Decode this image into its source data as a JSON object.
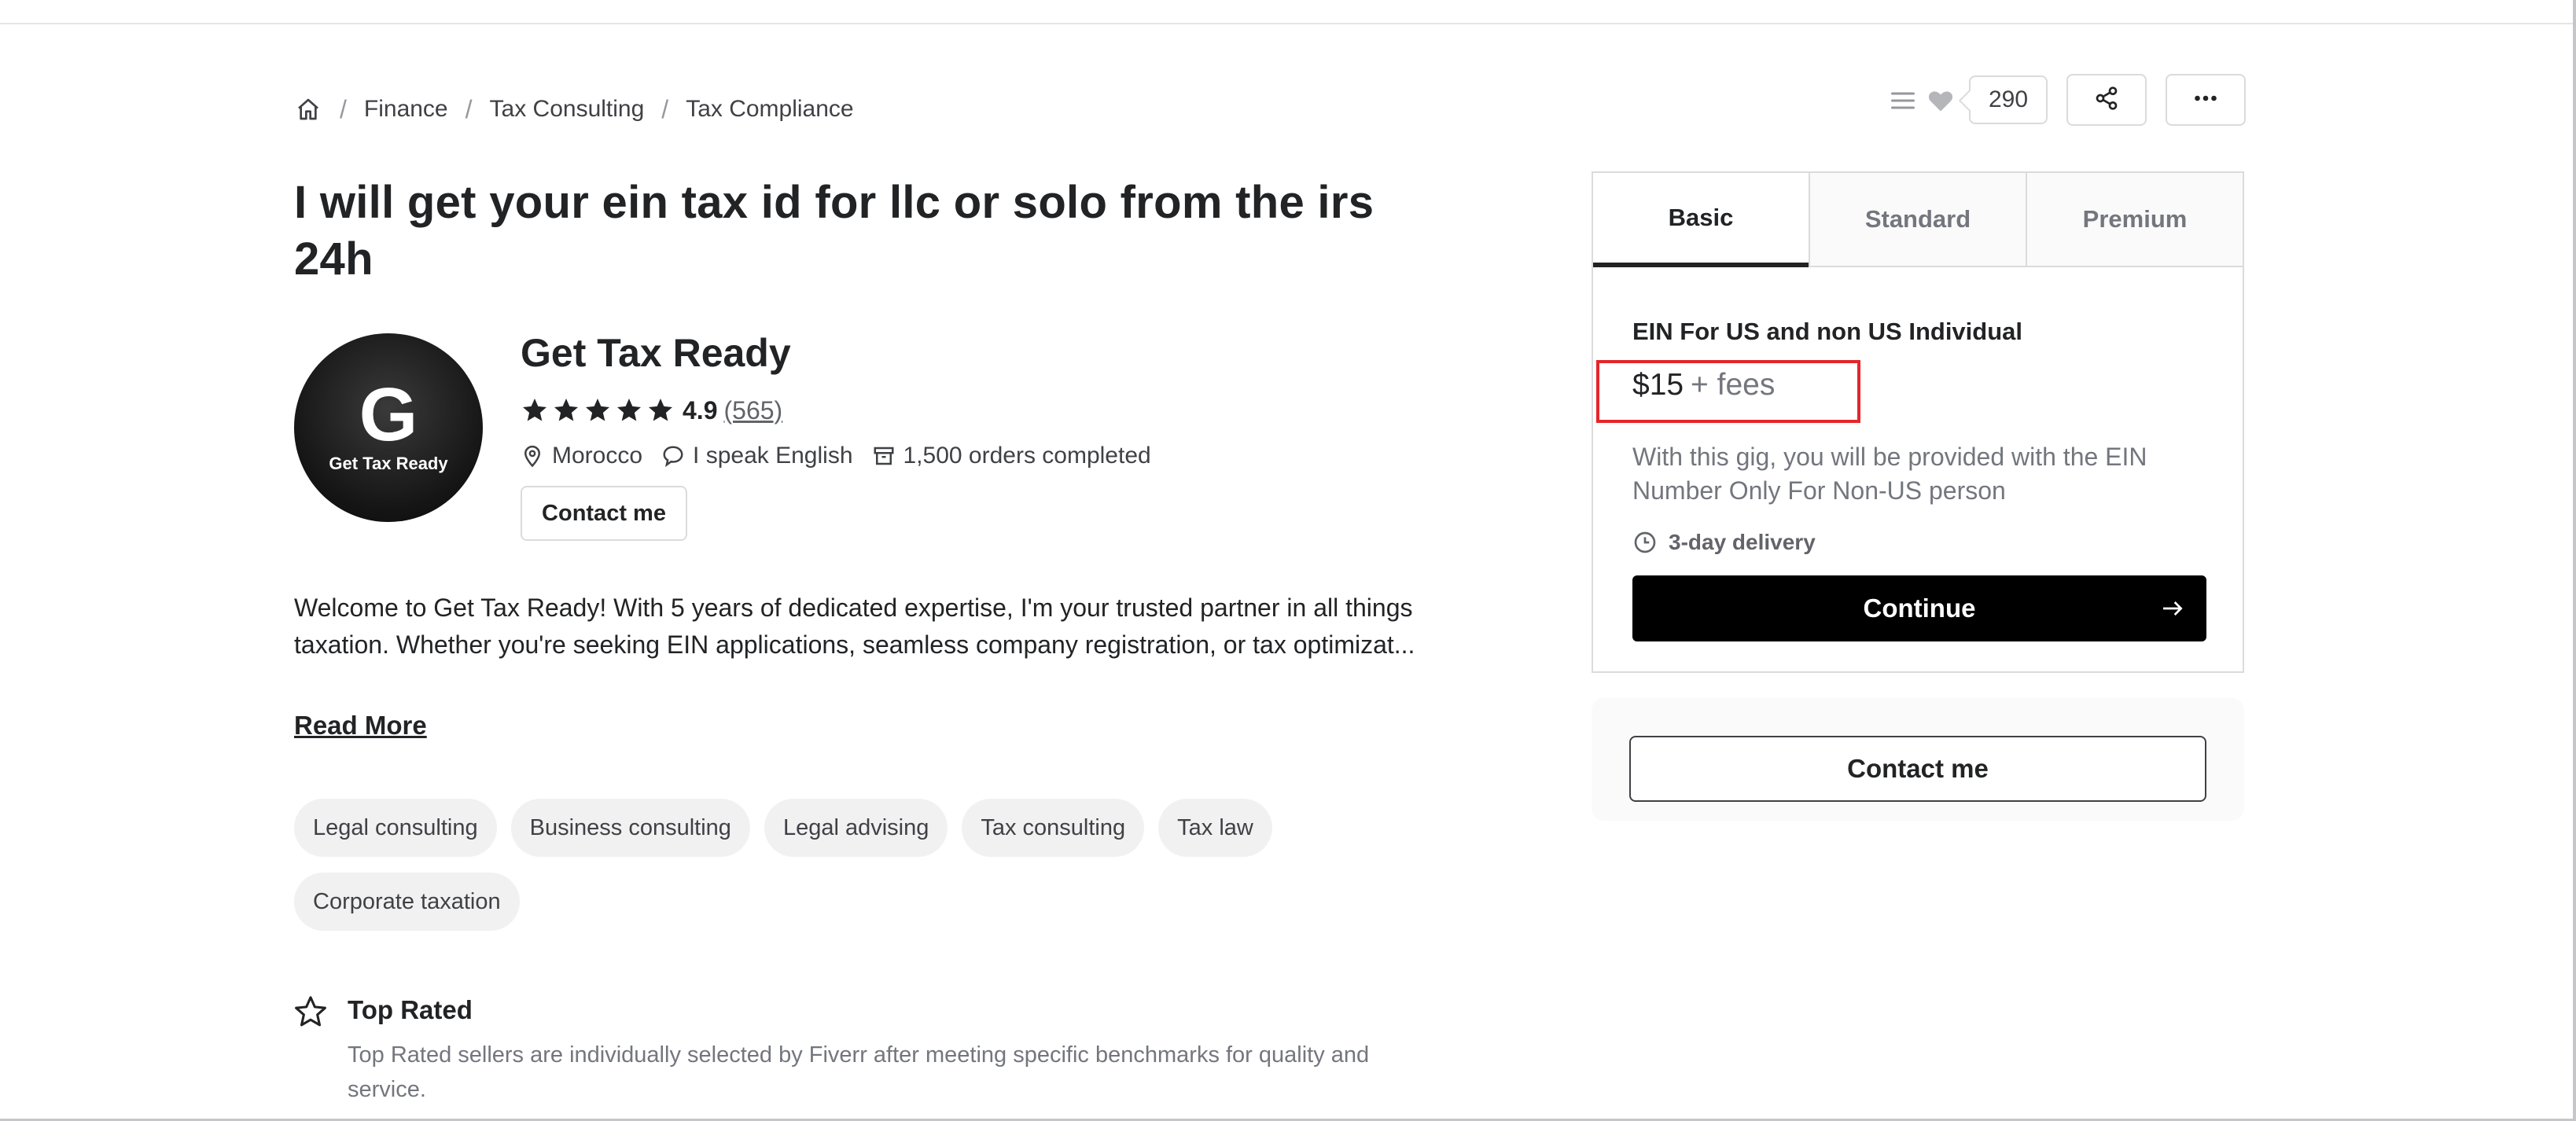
{
  "breadcrumb": {
    "home_icon": "home-icon",
    "items": [
      "Finance",
      "Tax Consulting",
      "Tax Compliance"
    ]
  },
  "actions": {
    "list_icon": "list-icon",
    "heart_icon": "heart-icon",
    "likes": "290",
    "share_icon": "share-icon",
    "more_icon": "more-horizontal-icon"
  },
  "gig": {
    "title": "I will get your ein tax id for llc or solo from the irs 24h"
  },
  "seller": {
    "avatar_letter": "G",
    "avatar_text": "Get Tax Ready",
    "name": "Get Tax Ready",
    "rating": "4.9",
    "stars": 5,
    "reviews": "(565)",
    "location": "Morocco",
    "language": "I speak English",
    "orders": "1,500 orders completed",
    "contact_label": "Contact me"
  },
  "description": {
    "text": "Welcome to Get Tax Ready! With 5 years of dedicated expertise, I'm your trusted partner in all things taxation. Whether you're seeking EIN applications, seamless company registration, or tax optimizat...",
    "read_more": "Read More"
  },
  "tags": [
    "Legal consulting",
    "Business consulting",
    "Legal advising",
    "Tax consulting",
    "Tax law",
    "Corporate taxation"
  ],
  "top_rated": {
    "title": "Top Rated",
    "description": "Top Rated sellers are individually selected by Fiverr after meeting specific benchmarks for quality and service."
  },
  "package": {
    "tabs": [
      "Basic",
      "Standard",
      "Premium"
    ],
    "active_tab": "Basic",
    "name": "EIN For US and non US Individual",
    "price": "$15",
    "fees": "+ fees",
    "description": "With this gig, you will be provided with the EIN Number Only For Non-US person",
    "delivery": "3-day delivery",
    "continue_label": "Continue"
  },
  "contact_panel": {
    "label": "Contact me"
  },
  "colors": {
    "text": "#222325",
    "muted": "#74767e",
    "highlight_box": "#e5262a",
    "button": "#000000"
  }
}
